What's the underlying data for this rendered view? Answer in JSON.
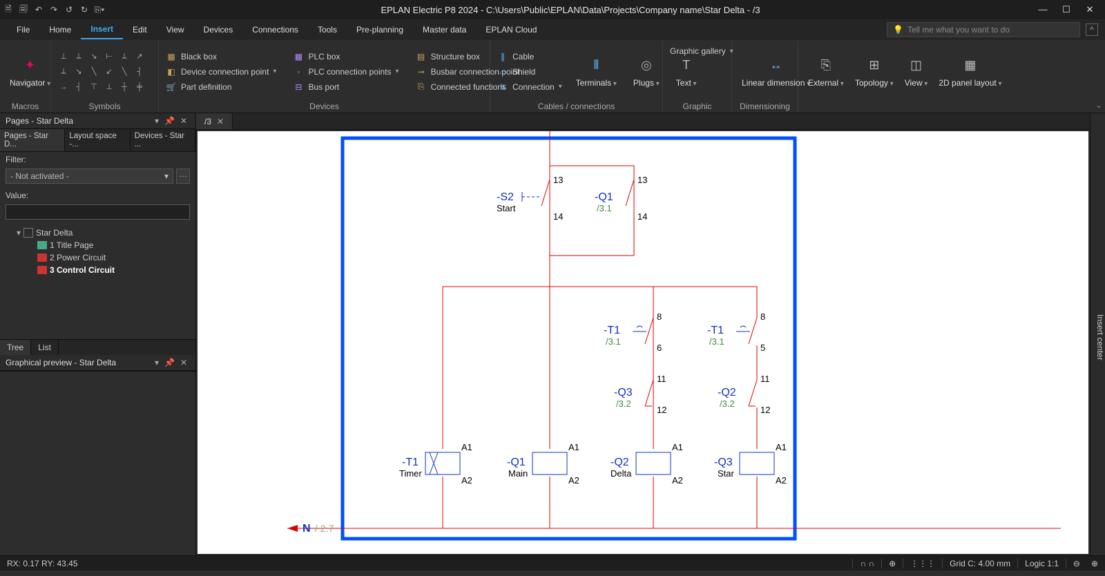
{
  "title": "EPLAN Electric P8 2024 - C:\\Users\\Public\\EPLAN\\Data\\Projects\\Company name\\Star Delta - /3",
  "menu": [
    "File",
    "Home",
    "Insert",
    "Edit",
    "View",
    "Devices",
    "Connections",
    "Tools",
    "Pre-planning",
    "Master data",
    "EPLAN Cloud"
  ],
  "menu_active": "Insert",
  "search_placeholder": "Tell me what you want to do",
  "ribbon": {
    "macros": {
      "navigator": "Navigator",
      "label": "Macros"
    },
    "symbols": {
      "label": "Symbols"
    },
    "devices": {
      "black_box": "Black box",
      "device_conn": "Device connection point",
      "part_def": "Part definition",
      "plc_box": "PLC box",
      "plc_conn": "PLC connection points",
      "bus_port": "Bus port",
      "structure_box": "Structure box",
      "busbar": "Busbar connection point",
      "connected": "Connected functions",
      "label": "Devices"
    },
    "cables": {
      "cable": "Cable",
      "shield": "Shield",
      "connection": "Connection",
      "terminals": "Terminals",
      "plugs": "Plugs",
      "text": "Text",
      "label": "Cables / connections"
    },
    "graphic": {
      "gallery": "Graphic gallery",
      "label": "Graphic"
    },
    "dim": {
      "linear": "Linear dimension",
      "label": "Dimensioning"
    },
    "right": {
      "external": "External",
      "topology": "Topology",
      "view": "View",
      "panel": "2D panel layout"
    }
  },
  "sidepanel": {
    "pages_title": "Pages - Star Delta",
    "tabs": [
      "Pages - Star D...",
      "Layout space -...",
      "Devices - Star ..."
    ],
    "filter_label": "Filter:",
    "filter_value": "- Not activated -",
    "value_label": "Value:",
    "tree_root": "Star Delta",
    "tree_pages": [
      "1 Title Page",
      "2 Power Circuit",
      "3 Control Circuit"
    ],
    "bottomtabs": [
      "Tree",
      "List"
    ],
    "preview_title": "Graphical preview - Star Delta"
  },
  "doctab": "/3",
  "insert_center": "Insert center",
  "status": {
    "coords": "RX: 0.17 RY: 43.45",
    "grid": "Grid C: 4.00 mm",
    "logic": "Logic 1:1"
  },
  "schematic": {
    "s2": {
      "tag": "-S2",
      "sub": "Start",
      "pin_t": "13",
      "pin_b": "14"
    },
    "q1a": {
      "tag": "-Q1",
      "sub": "/3.1",
      "pin_t": "13",
      "pin_b": "14"
    },
    "t1a": {
      "tag": "-T1",
      "sub": "/3.1",
      "pin_t": "8",
      "pin_b": "6"
    },
    "t1b": {
      "tag": "-T1",
      "sub": "/3.1",
      "pin_t": "8",
      "pin_b": "5"
    },
    "q3a": {
      "tag": "-Q3",
      "sub": "/3.2",
      "pin_t": "11",
      "pin_b": "12"
    },
    "q2a": {
      "tag": "-Q2",
      "sub": "/3.2",
      "pin_t": "11",
      "pin_b": "12"
    },
    "coils": [
      {
        "tag": "-T1",
        "sub": "Timer",
        "a1": "A1",
        "a2": "A2"
      },
      {
        "tag": "-Q1",
        "sub": "Main",
        "a1": "A1",
        "a2": "A2"
      },
      {
        "tag": "-Q2",
        "sub": "Delta",
        "a1": "A1",
        "a2": "A2"
      },
      {
        "tag": "-Q3",
        "sub": "Star",
        "a1": "A1",
        "a2": "A2"
      }
    ],
    "neutral": "N",
    "neutral_ref": "/ 2.7"
  }
}
